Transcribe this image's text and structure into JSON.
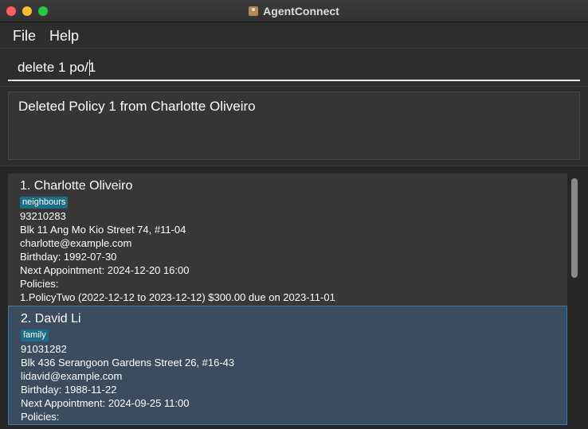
{
  "window": {
    "title": "AgentConnect"
  },
  "menu": {
    "file": "File",
    "help": "Help"
  },
  "command": {
    "value": "delete 1 po/1"
  },
  "result": {
    "text": "Deleted Policy 1 from Charlotte Oliveiro"
  },
  "persons": [
    {
      "name": "1. Charlotte Oliveiro",
      "tag": "neighbours",
      "phone": "93210283",
      "address": "Blk 11 Ang Mo Kio Street 74, #11-04",
      "email": "charlotte@example.com",
      "birthday": "Birthday: 1992-07-30",
      "appointment": "Next Appointment: 2024-12-20 16:00",
      "policies_label": "Policies:",
      "policy_1": "1.PolicyTwo (2022-12-12 to 2023-12-12) $300.00 due on 2023-11-01"
    },
    {
      "name": "2. David Li",
      "tag": "family",
      "phone": "91031282",
      "address": "Blk 436 Serangoon Gardens Street 26, #16-43",
      "email": "lidavid@example.com",
      "birthday": "Birthday: 1988-11-22",
      "appointment": "Next Appointment: 2024-09-25 11:00",
      "policies_label": "Policies:"
    }
  ]
}
